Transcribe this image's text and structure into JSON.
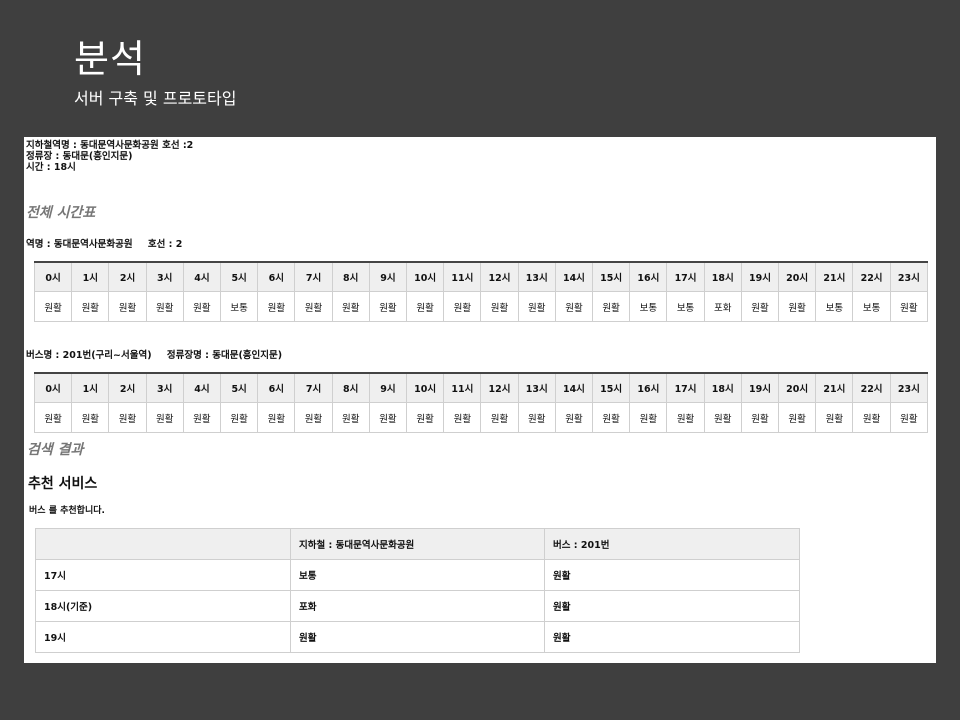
{
  "slide": {
    "title": "분석",
    "subtitle": "서버 구축 및 프로토타입"
  },
  "info": {
    "line1": "지하철역명 : 동대문역사문화공원 호선 :2",
    "line2": "정류장 : 동대문(흥인지문)",
    "line3": "시간 : 18시"
  },
  "section_all_timetable": "전체 시간표",
  "section_search_result": "검색 결과",
  "subway": {
    "station_label": "역명 : 동대문역사문화공원",
    "line_label": "호선 : 2",
    "hours": [
      "0시",
      "1시",
      "2시",
      "3시",
      "4시",
      "5시",
      "6시",
      "7시",
      "8시",
      "9시",
      "10시",
      "11시",
      "12시",
      "13시",
      "14시",
      "15시",
      "16시",
      "17시",
      "18시",
      "19시",
      "20시",
      "21시",
      "22시",
      "23시"
    ],
    "status": [
      "원활",
      "원활",
      "원활",
      "원활",
      "원활",
      "보통",
      "원활",
      "원활",
      "원활",
      "원활",
      "원활",
      "원활",
      "원활",
      "원활",
      "원활",
      "원활",
      "보통",
      "보통",
      "포화",
      "원활",
      "원활",
      "보통",
      "보통",
      "원활"
    ]
  },
  "bus": {
    "bus_label": "버스명 : 201번(구리~서울역)",
    "stop_label": "정류장명 : 동대문(흥인지문)",
    "hours": [
      "0시",
      "1시",
      "2시",
      "3시",
      "4시",
      "5시",
      "6시",
      "7시",
      "8시",
      "9시",
      "10시",
      "11시",
      "12시",
      "13시",
      "14시",
      "15시",
      "16시",
      "17시",
      "18시",
      "19시",
      "20시",
      "21시",
      "22시",
      "23시"
    ],
    "status": [
      "원활",
      "원활",
      "원활",
      "원활",
      "원활",
      "원활",
      "원활",
      "원활",
      "원활",
      "원활",
      "원활",
      "원활",
      "원활",
      "원활",
      "원활",
      "원활",
      "원활",
      "원활",
      "원활",
      "원활",
      "원활",
      "원활",
      "원활",
      "원활"
    ]
  },
  "recommend": {
    "title": "추천 서비스",
    "note": "버스 를 추천합니다.",
    "header": [
      "",
      "지하철 : 동대문역사문화공원",
      "버스 : 201번"
    ],
    "rows": [
      [
        "17시",
        "보통",
        "원활"
      ],
      [
        "18시(기준)",
        "포화",
        "원활"
      ],
      [
        "19시",
        "원활",
        "원활"
      ]
    ]
  }
}
